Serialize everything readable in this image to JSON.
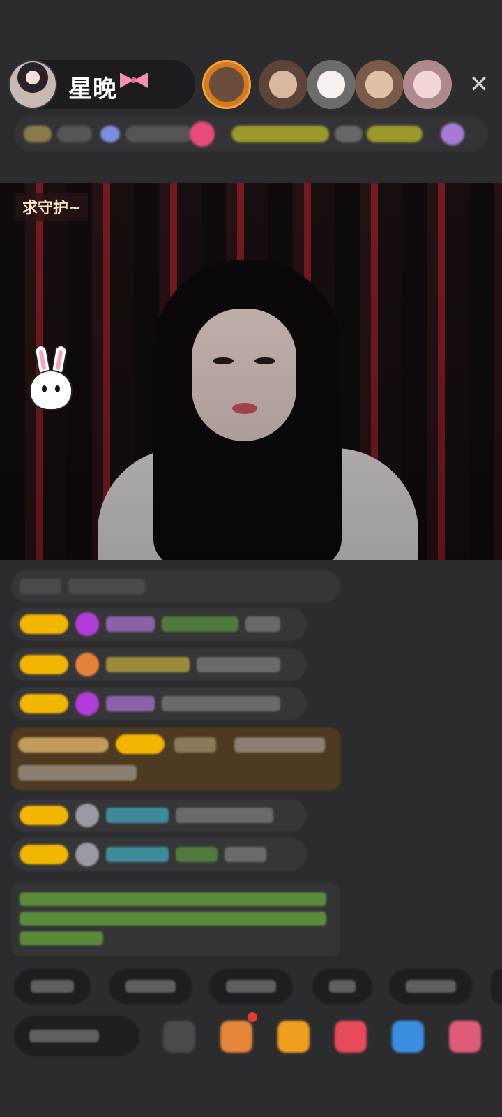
{
  "host": {
    "name": "星晚",
    "name_icon": "bow-icon"
  },
  "header": {
    "close_icon": "close-icon",
    "close_symbol": "✕"
  },
  "video": {
    "overlay_text": "求守护~",
    "sticker_icon": "rabbit-icon"
  },
  "colors": {
    "background": "#2c2c2e",
    "badge_gold": "#f2b600",
    "promo_brown": "#4e3a21",
    "system_green": "#5a8a3a"
  }
}
